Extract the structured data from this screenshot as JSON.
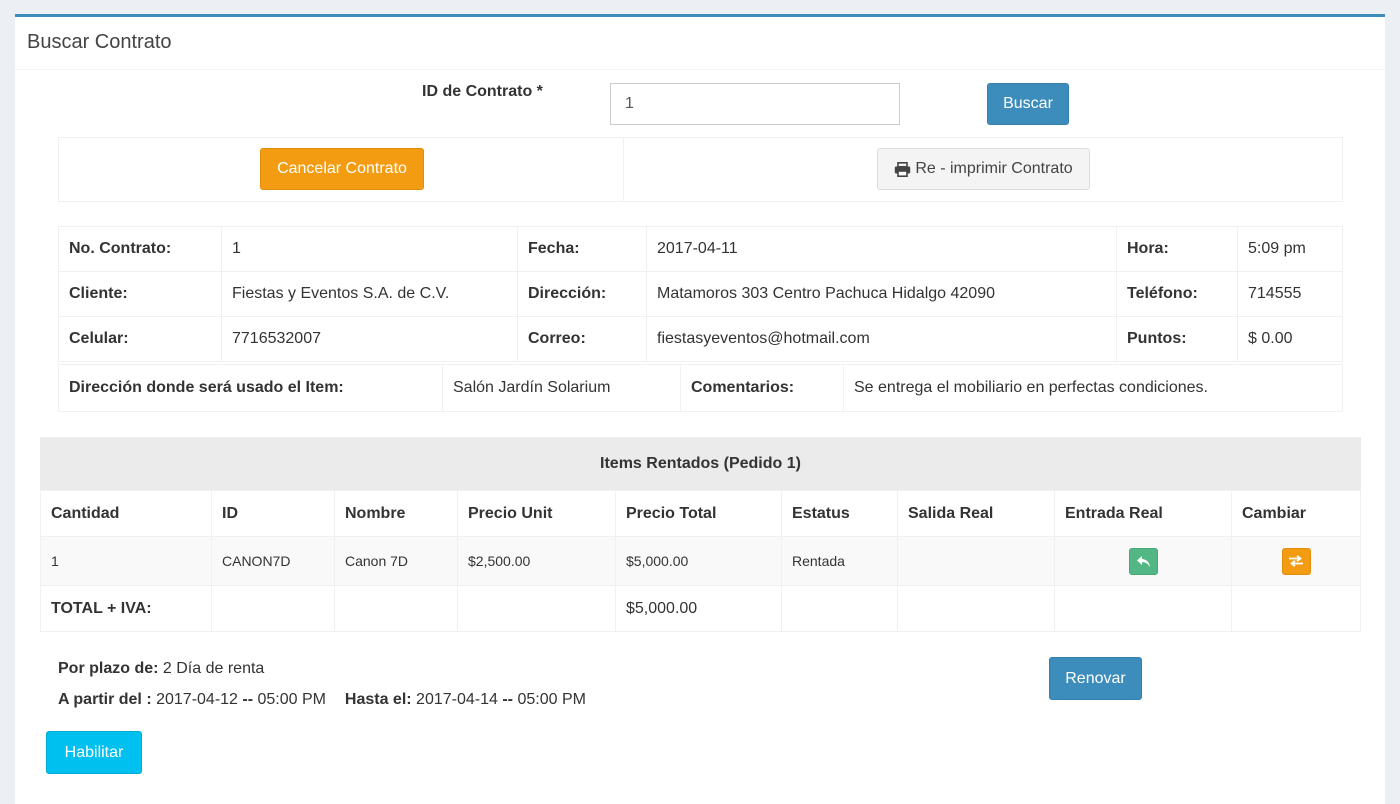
{
  "header": {
    "title": "Buscar Contrato"
  },
  "search": {
    "label": "ID de Contrato *",
    "value": "1",
    "button": "Buscar"
  },
  "actions": {
    "cancel": "Cancelar Contrato",
    "reprint": "Re - imprimir Contrato"
  },
  "contract": {
    "no_label": "No. Contrato:",
    "no": "1",
    "fecha_label": "Fecha:",
    "fecha": "2017-04-11",
    "hora_label": "Hora:",
    "hora": "5:09 pm",
    "cliente_label": "Cliente:",
    "cliente": "Fiestas y Eventos S.A. de C.V.",
    "direccion_label": "Dirección:",
    "direccion": "Matamoros 303 Centro Pachuca Hidalgo 42090",
    "telefono_label": "Teléfono:",
    "telefono": "714555",
    "celular_label": "Celular:",
    "celular": "7716532007",
    "correo_label": "Correo:",
    "correo": "fiestasyeventos@hotmail.com",
    "puntos_label": "Puntos:",
    "puntos": "$ 0.00",
    "dir_uso_label": "Dirección donde será usado el Item:",
    "dir_uso": "Salón Jardín Solarium",
    "comentarios_label": "Comentarios:",
    "comentarios": "Se entrega el mobiliario en perfectas condiciones."
  },
  "items": {
    "title": "Items Rentados (Pedido 1)",
    "columns": [
      "Cantidad",
      "ID",
      "Nombre",
      "Precio Unit",
      "Precio Total",
      "Estatus",
      "Salida Real",
      "Entrada Real",
      "Cambiar"
    ],
    "rows": [
      {
        "cantidad": "1",
        "id": "CANON7D",
        "nombre": "Canon 7D",
        "precio_unit": "$2,500.00",
        "precio_total": "$5,000.00",
        "estatus": "Rentada",
        "salida_real": ""
      }
    ],
    "total_label": "TOTAL + IVA:",
    "total": "$5,000.00"
  },
  "plazo": {
    "label": "Por plazo de:",
    "value": "2 Día de renta",
    "desde_label": "A partir del :",
    "desde_fecha": "2017-04-12",
    "sep": "--",
    "desde_hora": "05:00 PM",
    "hasta_label": "Hasta el:",
    "hasta_fecha": "2017-04-14",
    "hasta_hora": "05:00 PM"
  },
  "buttons": {
    "renovar": "Renovar",
    "habilitar": "Habilitar"
  },
  "icons": {
    "entrada": "reply-icon",
    "cambiar": "exchange-icon",
    "print": "print-icon"
  },
  "colors": {
    "primary": "#3c8dbc",
    "warning": "#f39c12",
    "info": "#00c0ef",
    "success": "#52b784"
  }
}
